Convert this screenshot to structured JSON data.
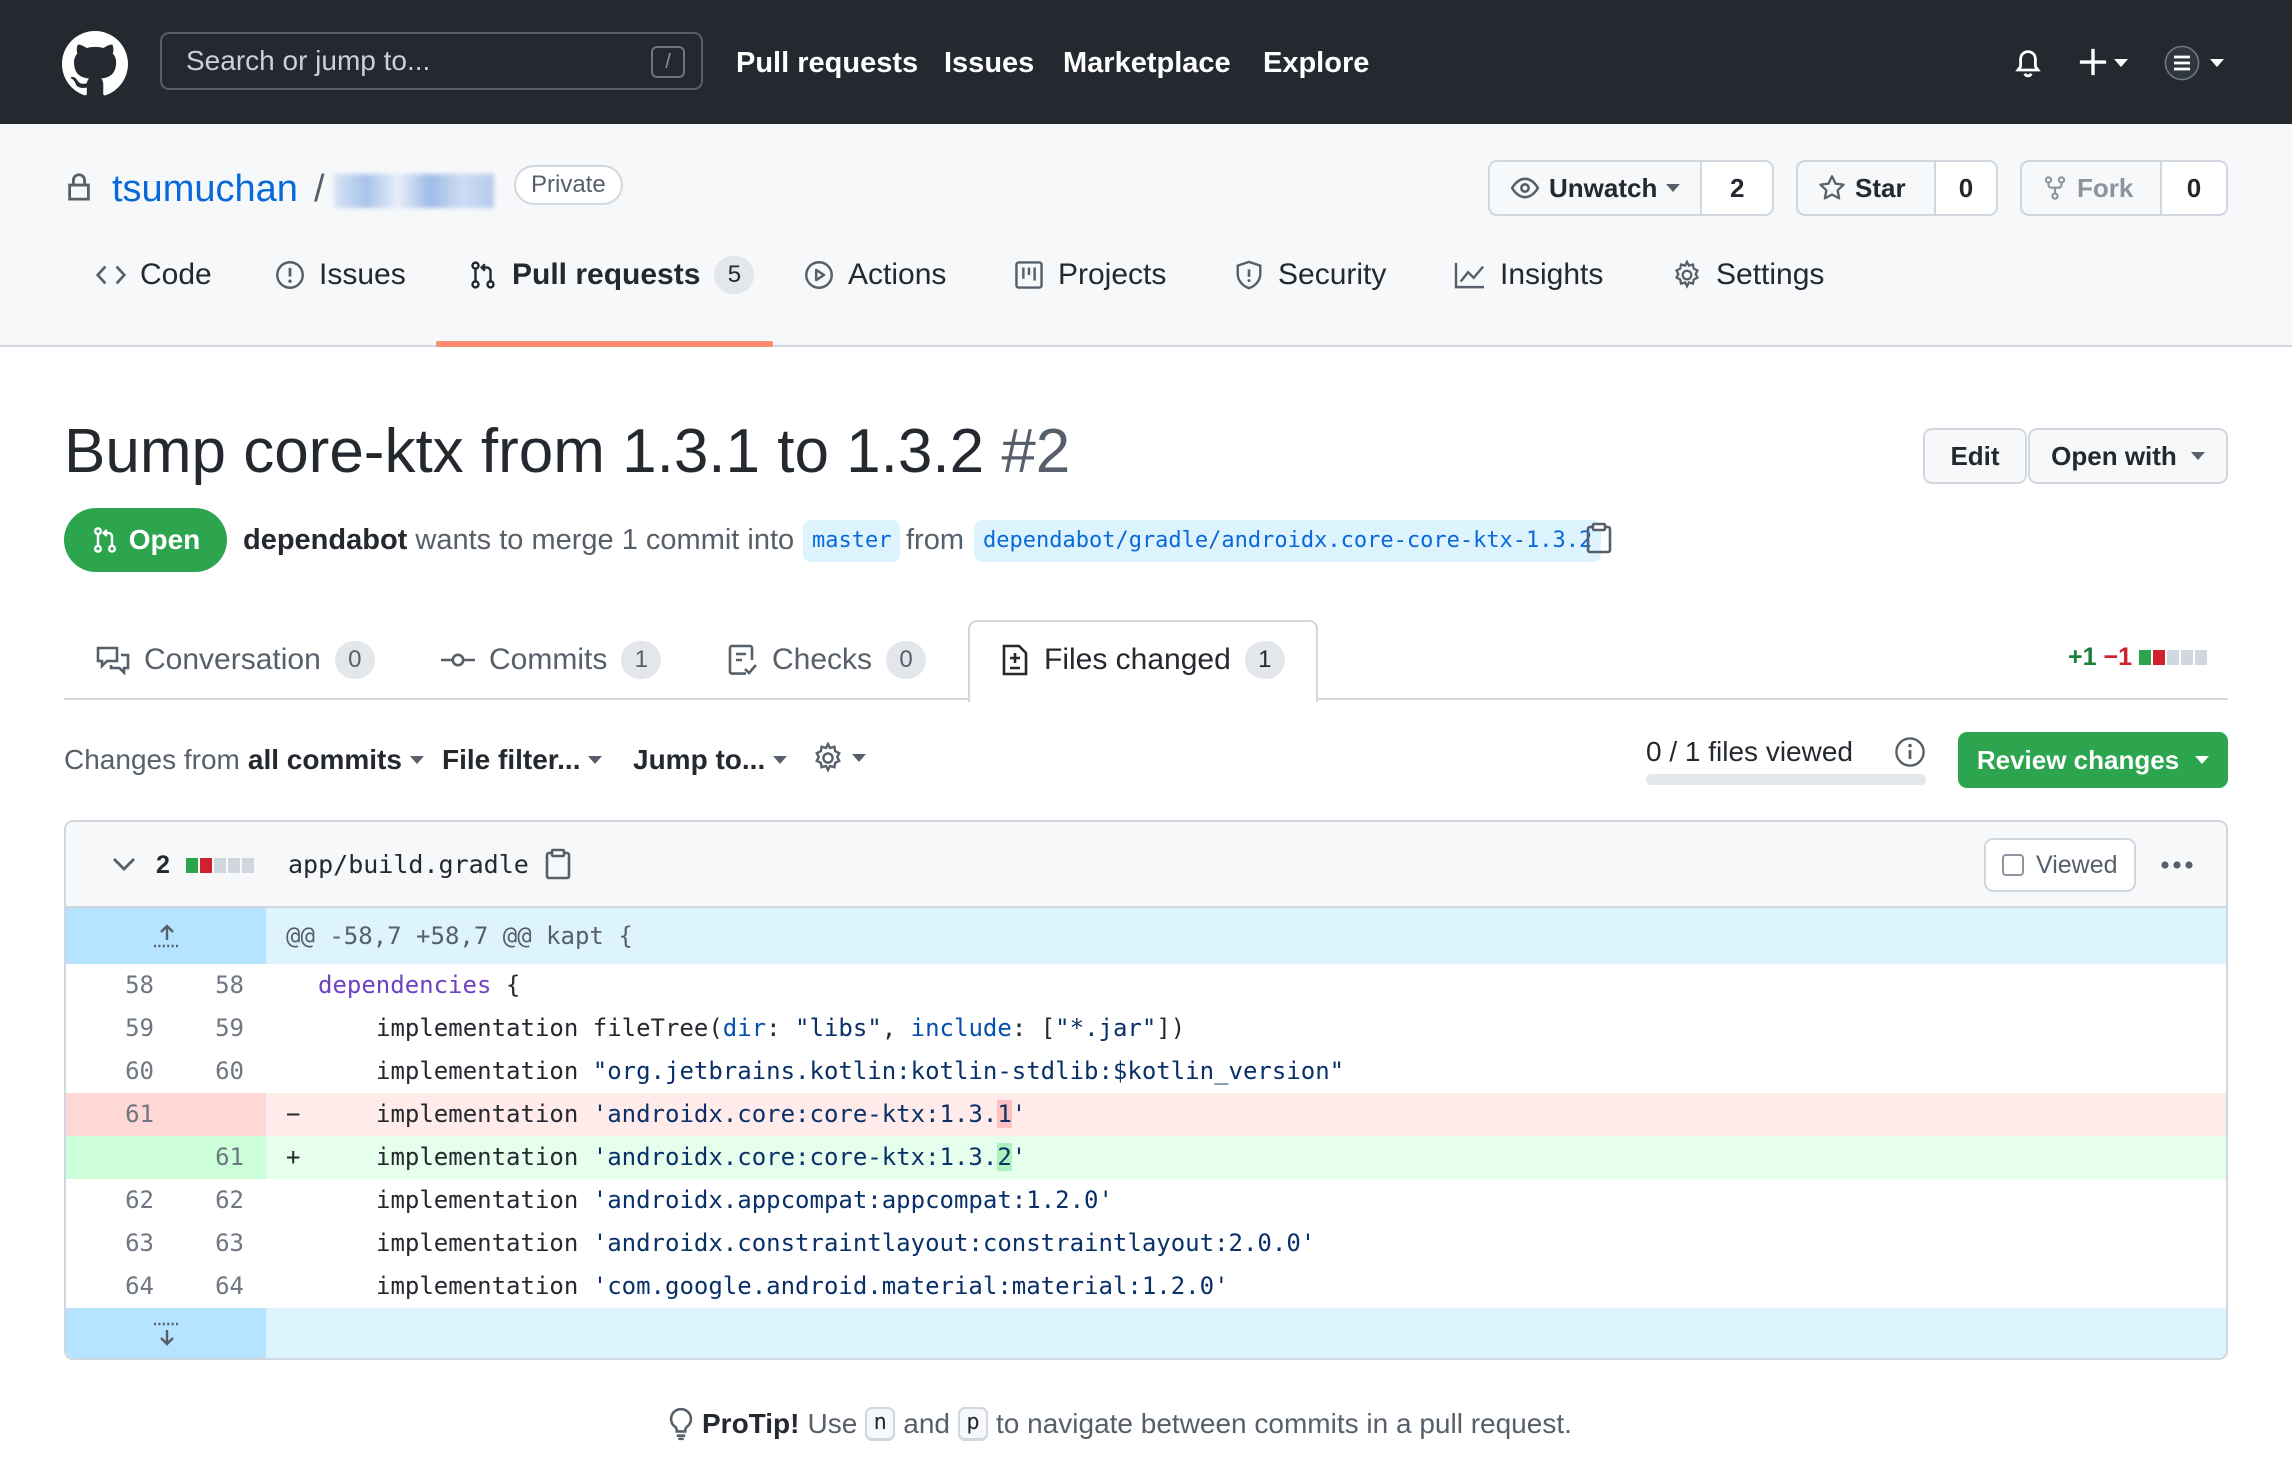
{
  "header": {
    "search_placeholder": "Search or jump to...",
    "search_shortcut": "/",
    "nav": [
      "Pull requests",
      "Issues",
      "Marketplace",
      "Explore"
    ]
  },
  "repo": {
    "owner": "tsumuchan",
    "separator": "/",
    "visibility": "Private",
    "watch": {
      "label": "Unwatch",
      "count": "2"
    },
    "star": {
      "label": "Star",
      "count": "0"
    },
    "fork": {
      "label": "Fork",
      "count": "0"
    },
    "tabs": [
      {
        "label": "Code",
        "icon": "code-icon"
      },
      {
        "label": "Issues",
        "icon": "issue-icon"
      },
      {
        "label": "Pull requests",
        "icon": "pull-request-icon",
        "count": "5"
      },
      {
        "label": "Actions",
        "icon": "play-icon"
      },
      {
        "label": "Projects",
        "icon": "project-icon"
      },
      {
        "label": "Security",
        "icon": "shield-icon"
      },
      {
        "label": "Insights",
        "icon": "graph-icon"
      },
      {
        "label": "Settings",
        "icon": "gear-icon"
      }
    ]
  },
  "pr": {
    "title": "Bump core-ktx from 1.3.1 to 1.3.2",
    "number": "#2",
    "edit_label": "Edit",
    "open_with_label": "Open with",
    "state": "Open",
    "author": "dependabot",
    "merge_text": "wants to merge 1 commit into",
    "base_branch": "master",
    "from_text": "from",
    "head_branch": "dependabot/gradle/androidx.core-core-ktx-1.3.2",
    "tabs": [
      {
        "label": "Conversation",
        "count": "0"
      },
      {
        "label": "Commits",
        "count": "1"
      },
      {
        "label": "Checks",
        "count": "0"
      },
      {
        "label": "Files changed",
        "count": "1"
      }
    ],
    "additions": "+1",
    "deletions": "−1"
  },
  "toolbar": {
    "changes_prefix": "Changes from",
    "changes_value": "all commits",
    "file_filter": "File filter...",
    "jump_to": "Jump to...",
    "files_viewed": "0 / 1 files viewed",
    "files_viewed_fraction": 0,
    "review_button": "Review changes"
  },
  "file": {
    "change_count": "2",
    "path": "app/build.gradle",
    "viewed_label": "Viewed",
    "hunk_header": "@@ -58,7 +58,7 @@ kapt {",
    "lines": [
      {
        "old": "58",
        "new": "58",
        "type": "ctx"
      },
      {
        "old": "59",
        "new": "59",
        "type": "ctx"
      },
      {
        "old": "60",
        "new": "60",
        "type": "ctx"
      },
      {
        "old": "61",
        "new": "",
        "type": "del"
      },
      {
        "old": "",
        "new": "61",
        "type": "add"
      },
      {
        "old": "62",
        "new": "62",
        "type": "ctx"
      },
      {
        "old": "63",
        "new": "63",
        "type": "ctx"
      },
      {
        "old": "64",
        "new": "64",
        "type": "ctx"
      }
    ],
    "code": {
      "l58_kw": "dependencies",
      "l58_rest": " {",
      "l59_a": "implementation fileTree(",
      "l59_dir": "dir",
      "l59_b": ": ",
      "l59_s1": "\"libs\"",
      "l59_c": ", ",
      "l59_inc": "include",
      "l59_d": ": [",
      "l59_s2": "\"*.jar\"",
      "l59_e": "])",
      "l60_a": "implementation ",
      "l60_s": "\"org.jetbrains.kotlin:kotlin-stdlib:$kotlin_version\"",
      "l61_a": "implementation ",
      "l61_s": "'androidx.core:core-ktx:1.3.",
      "l61_h": "1",
      "l61_e": "'",
      "l61n_a": "implementation ",
      "l61n_s": "'androidx.core:core-ktx:1.3.",
      "l61n_h": "2",
      "l61n_e": "'",
      "l62_a": "implementation ",
      "l62_s": "'androidx.appcompat:appcompat:1.2.0'",
      "l63_a": "implementation ",
      "l63_s": "'androidx.constraintlayout:constraintlayout:2.0.0'",
      "l64_a": "implementation ",
      "l64_s": "'com.google.android.material:material:1.2.0'",
      "minus": "−",
      "plus": "+"
    }
  },
  "protip": {
    "label": "ProTip!",
    "text1": "Use",
    "key_next": "n",
    "text2": "and",
    "key_prev": "p",
    "text3": "to navigate between commits in a pull request."
  },
  "colors": {
    "accent": "#0969da",
    "green": "#2da44e",
    "red": "#cf222e",
    "header_bg": "#24292f"
  }
}
